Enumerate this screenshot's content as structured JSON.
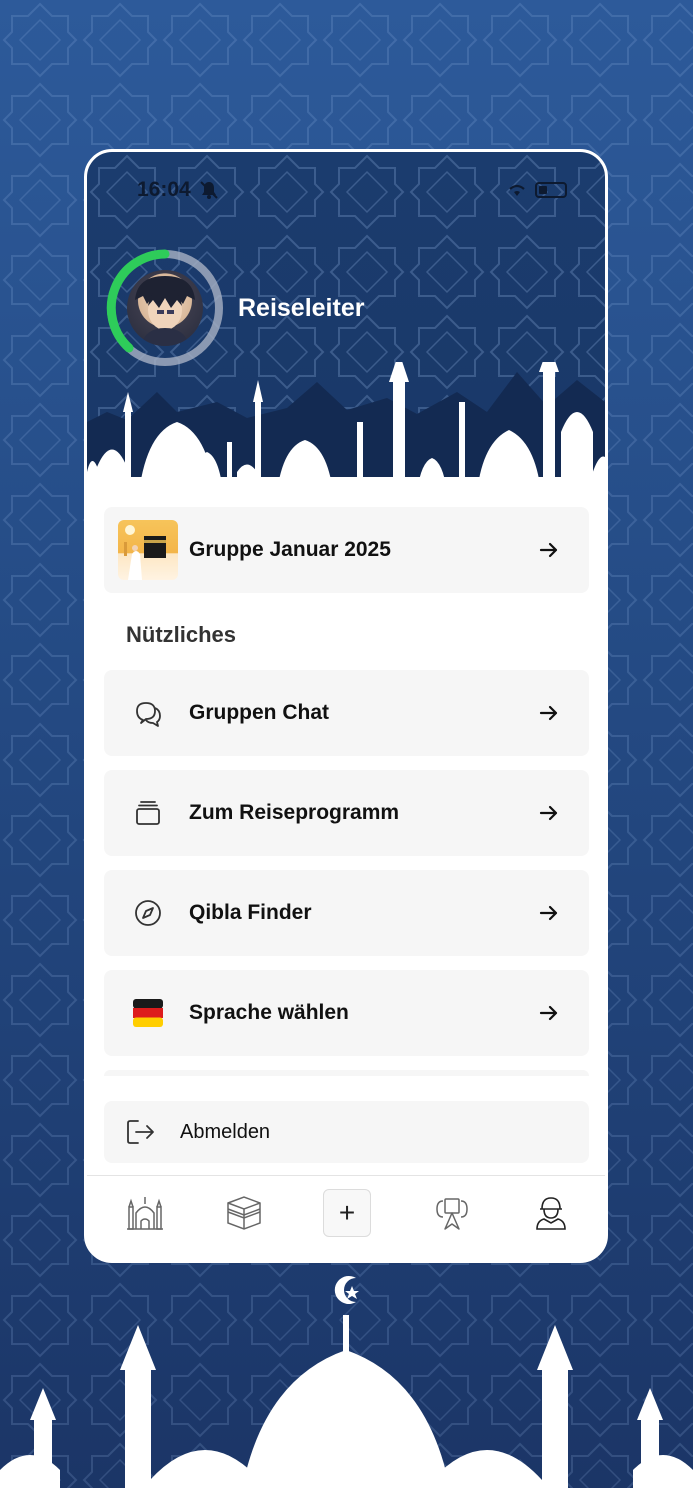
{
  "status_bar": {
    "time": "16:04",
    "battery_level": 0.15
  },
  "profile": {
    "name": "Reiseleiter",
    "progress": 0.38
  },
  "group": {
    "label": "Gruppe Januar 2025"
  },
  "section": {
    "title": "Nützliches"
  },
  "menu": {
    "items": [
      {
        "label": "Gruppen Chat",
        "icon": "chat-icon"
      },
      {
        "label": "Zum Reiseprogramm",
        "icon": "stack-icon"
      },
      {
        "label": "Qibla Finder",
        "icon": "compass-icon"
      },
      {
        "label": "Sprache wählen",
        "icon": "german-flag-icon"
      }
    ]
  },
  "logout": {
    "label": "Abmelden"
  },
  "tabbar": {
    "items": [
      "mosque-icon",
      "kaaba-icon",
      "plus-icon",
      "map-guide-icon",
      "profile-icon"
    ],
    "plus_symbol": "+"
  },
  "colors": {
    "accent_green": "#2ecc5a",
    "header_blue": "#1b3c6e",
    "background_blue": "#254c86",
    "card_bg": "#f6f6f6"
  }
}
